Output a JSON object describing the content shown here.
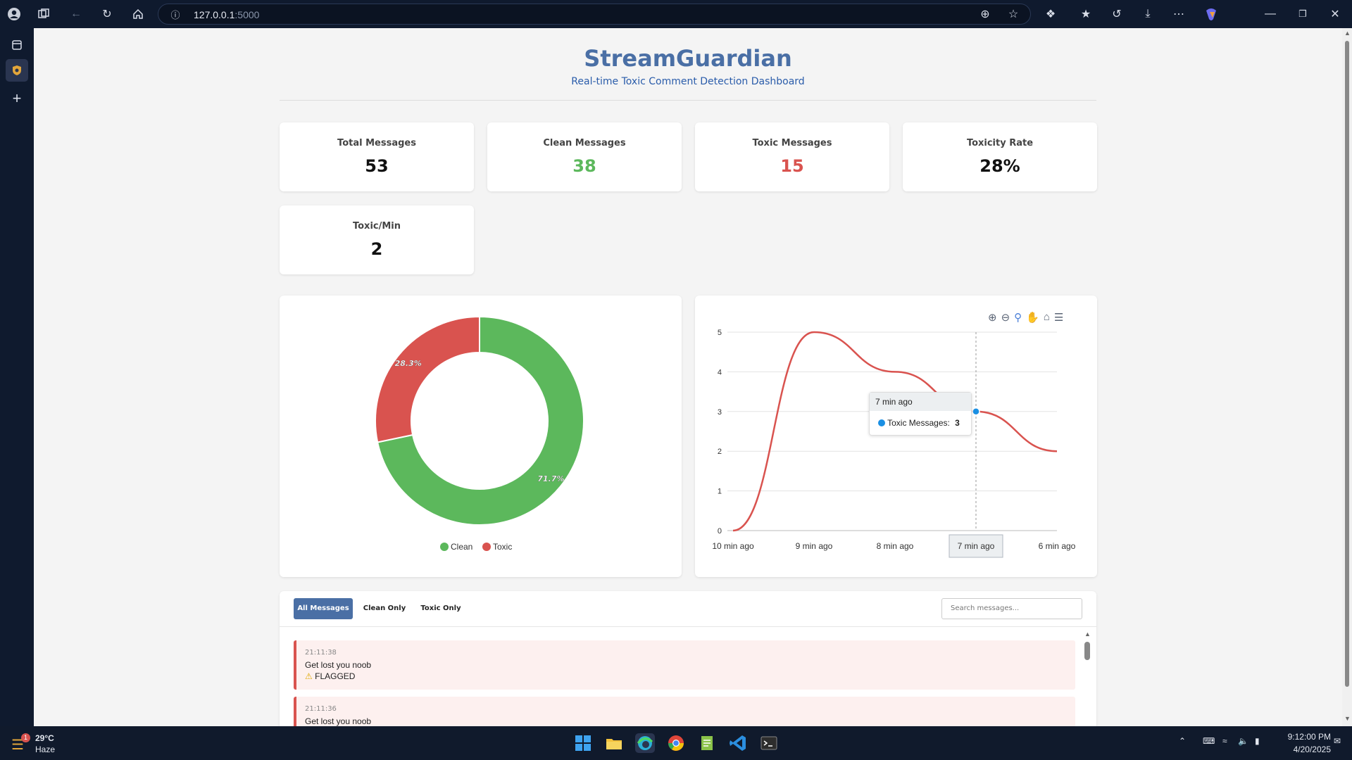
{
  "browser": {
    "url_host": "127.0.0.1",
    "url_port": ":5000"
  },
  "page": {
    "title": "StreamGuardian",
    "subtitle": "Real-time Toxic Comment Detection Dashboard"
  },
  "stats": [
    {
      "label": "Total Messages",
      "value": "53",
      "color": "#111111"
    },
    {
      "label": "Clean Messages",
      "value": "38",
      "color": "#5cb85c"
    },
    {
      "label": "Toxic Messages",
      "value": "15",
      "color": "#d9534f"
    },
    {
      "label": "Toxicity Rate",
      "value": "28%",
      "color": "#111111"
    },
    {
      "label": "Toxic/Min",
      "value": "2",
      "color": "#111111"
    }
  ],
  "chart_data": [
    {
      "type": "pie",
      "labels": [
        "Clean",
        "Toxic"
      ],
      "values": [
        71.7,
        28.3
      ],
      "value_labels": [
        "71.7%",
        "28.3%"
      ],
      "colors": [
        "#5cb85c",
        "#d9534f"
      ],
      "donut": true,
      "legend": "bottom"
    },
    {
      "type": "line",
      "categories": [
        "10 min ago",
        "9 min ago",
        "8 min ago",
        "7 min ago",
        "6 min ago"
      ],
      "series": [
        {
          "name": "Toxic Messages",
          "values": [
            0,
            5,
            4,
            3,
            2
          ],
          "color": "#d9534f"
        }
      ],
      "ylim": [
        0,
        5
      ],
      "yticks": [
        "0",
        "1",
        "2",
        "3",
        "4",
        "5"
      ],
      "grid": true,
      "tooltip": {
        "title": "7 min ago",
        "series": "Toxic Messages:",
        "value": "3"
      }
    }
  ],
  "messages_panel": {
    "filters": [
      "All Messages",
      "Clean Only",
      "Toxic Only"
    ],
    "search_placeholder": "Search messages...",
    "messages": [
      {
        "time": "21:11:38",
        "text": "Get lost you noob",
        "flag": "FLAGGED"
      },
      {
        "time": "21:11:36",
        "text": "Get lost you noob"
      }
    ]
  },
  "taskbar": {
    "weather_temp": "29°C",
    "weather_desc": "Haze",
    "weather_badge": "1",
    "time": "9:12:00 PM",
    "date": "4/20/2025"
  }
}
